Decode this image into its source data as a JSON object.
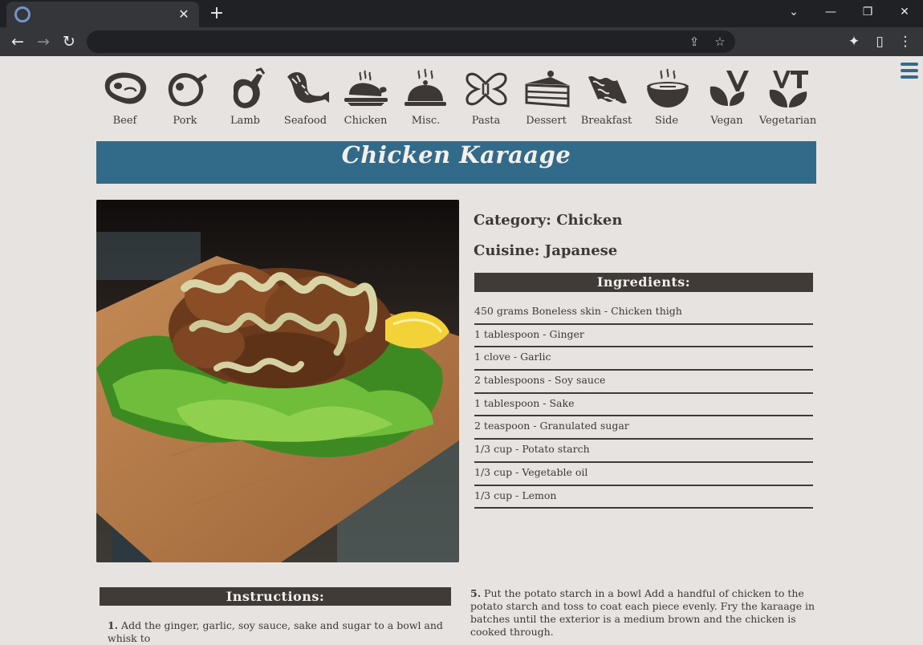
{
  "browser": {
    "tab_close": "✕",
    "new_tab": "+",
    "window_controls": [
      "⌄",
      "—",
      "❐",
      "✕"
    ]
  },
  "categories": [
    {
      "label": "Beef",
      "icon": "steak-icon"
    },
    {
      "label": "Pork",
      "icon": "ham-icon"
    },
    {
      "label": "Lamb",
      "icon": "lamb-leg-icon"
    },
    {
      "label": "Seafood",
      "icon": "shrimp-icon"
    },
    {
      "label": "Chicken",
      "icon": "roast-chicken-icon"
    },
    {
      "label": "Misc.",
      "icon": "cloche-icon"
    },
    {
      "label": "Pasta",
      "icon": "farfalle-icon"
    },
    {
      "label": "Dessert",
      "icon": "cake-slice-icon"
    },
    {
      "label": "Breakfast",
      "icon": "bacon-icon"
    },
    {
      "label": "Side",
      "icon": "bowl-icon"
    },
    {
      "label": "Vegan",
      "icon": "vegan-leaf-icon"
    },
    {
      "label": "Vegetarian",
      "icon": "vegetarian-leaf-icon"
    }
  ],
  "recipe": {
    "title": "Chicken Karaage",
    "category": "Category: Chicken",
    "cuisine": "Cuisine: Japanese",
    "ingredients_heading": "Ingredients:",
    "ingredients": [
      "450 grams Boneless skin - Chicken thigh",
      "1 tablespoon - Ginger",
      "1 clove - Garlic",
      "2 tablespoons - Soy sauce",
      "1 tablespoon - Sake",
      "2 teaspoon - Granulated sugar",
      "1/3 cup - Potato starch",
      "1/3 cup - Vegetable oil",
      "1/3 cup - Lemon"
    ],
    "instructions_heading": "Instructions:",
    "steps": [
      {
        "num": "1.",
        "text": "Add the ginger, garlic, soy sauce, sake and sugar to a bowl and whisk to"
      },
      {
        "num": "5.",
        "text": "Put the potato starch in a bowl Add a handful of chicken to the potato starch and toss to coat each piece evenly. Fry the karaage in batches until the exterior is a medium brown and the chicken is cooked through."
      }
    ]
  },
  "colors": {
    "page_bg": "#e7e3e0",
    "title_bar": "#326a8a",
    "heading_bar": "#413b38",
    "text": "#3d3836",
    "hamburger": "#336a8e"
  }
}
